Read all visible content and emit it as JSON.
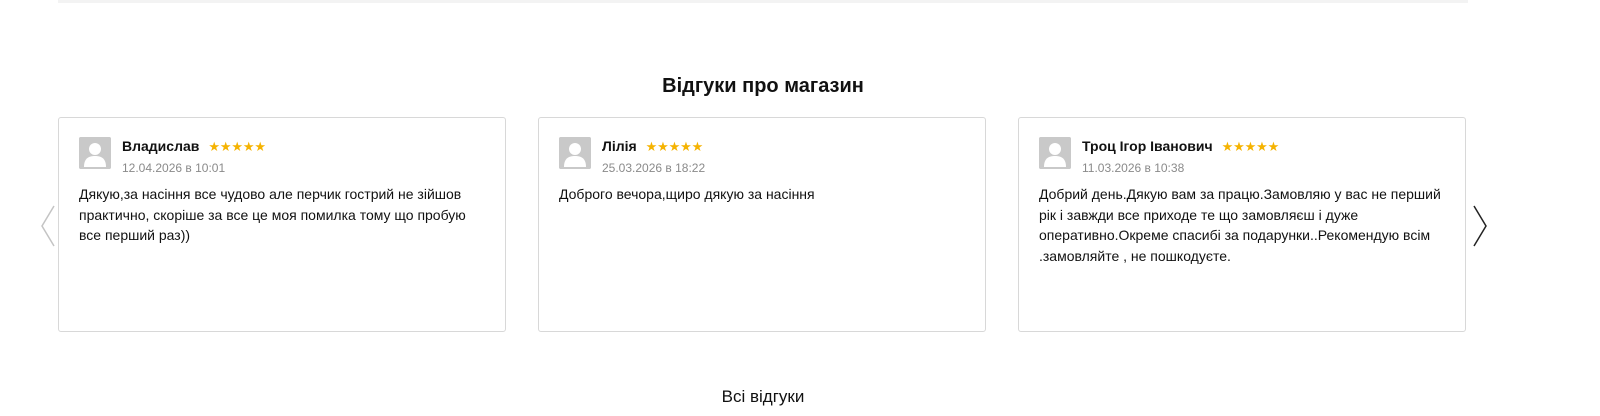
{
  "section": {
    "title": "Відгуки про магазин"
  },
  "reviews": [
    {
      "author": "Владислав",
      "rating": 5,
      "stars": "★★★★★",
      "date": "12.04.2026 в 10:01",
      "text": "Дякую,за насіння все чудово але перчик гострий не зійшов практично, скоріше за все це моя помилка тому що пробую все перший раз))"
    },
    {
      "author": "Лілія",
      "rating": 5,
      "stars": "★★★★★",
      "date": "25.03.2026 в 18:22",
      "text": "Доброго вечора,щиро дякую за насіння"
    },
    {
      "author": "Троц Ігор Іванович",
      "rating": 5,
      "stars": "★★★★★",
      "date": "11.03.2026 в 10:38",
      "text": "Добрий день.Дякую вам за працю.Замовляю у вас не перший рік і завжди все приходе те що замовляєш і дуже оперативно.Окреме спасибі за подарунки..Рекомендую всім .замовляйте , не пошкодуєте."
    }
  ],
  "carousel": {
    "prev_icon": "chevron-left-icon",
    "next_icon": "chevron-right-icon"
  },
  "footer": {
    "all_reviews_label": "Всі відгуки"
  },
  "colors": {
    "star": "#f5b301",
    "avatar_bg": "#c9c9c9",
    "card_border": "#d8d8d8",
    "date_text": "#8a8a8a"
  }
}
